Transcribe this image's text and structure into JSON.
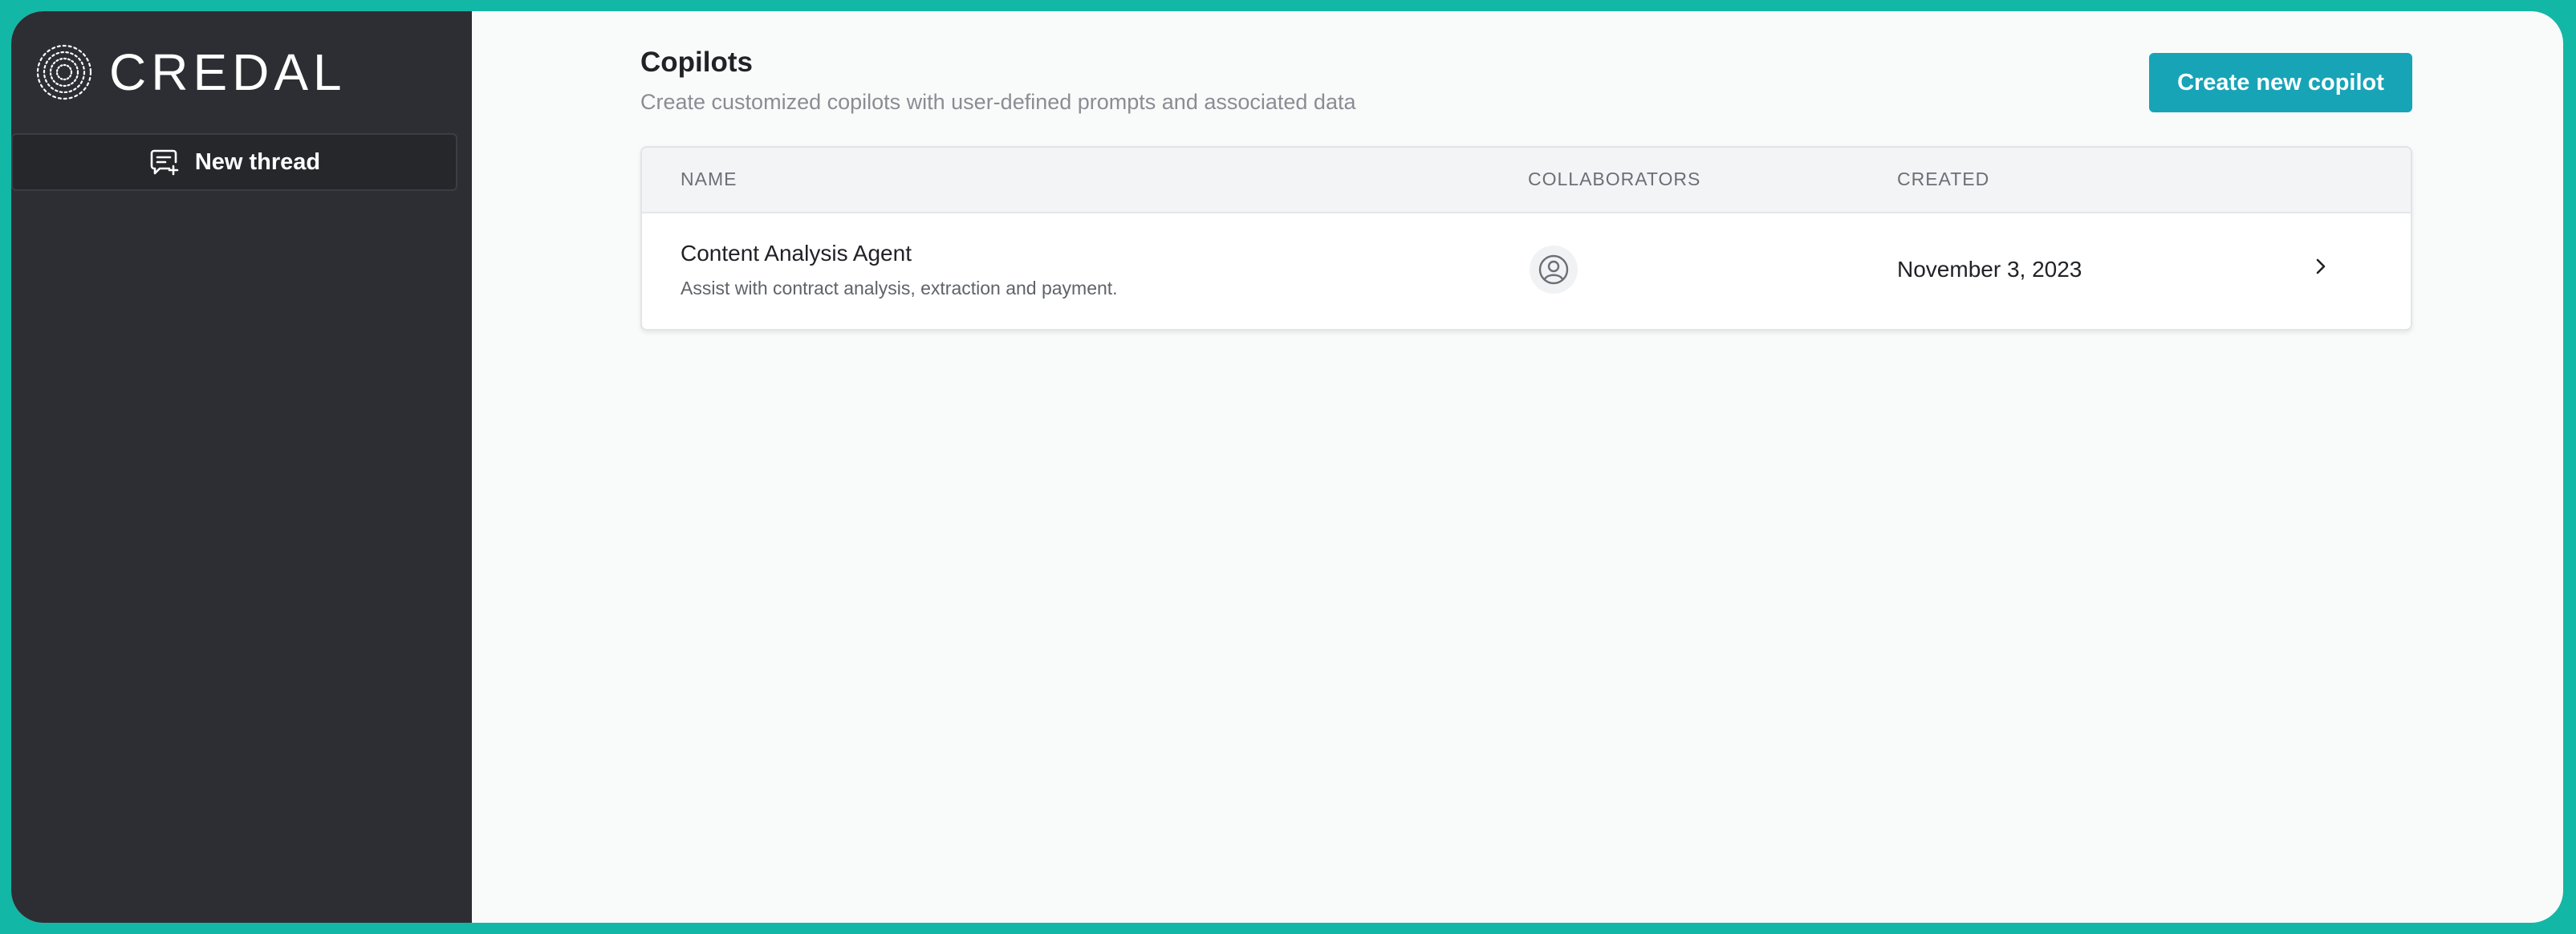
{
  "brand": {
    "name": "CREDAL"
  },
  "sidebar": {
    "new_thread_label": "New thread"
  },
  "page": {
    "title": "Copilots",
    "subtitle": "Create customized copilots with user-defined prompts and associated data",
    "create_button_label": "Create new copilot"
  },
  "table": {
    "columns": {
      "name": "NAME",
      "collaborators": "COLLABORATORS",
      "created": "CREATED"
    },
    "rows": [
      {
        "name": "Content Analysis Agent",
        "description": "Assist with contract analysis, extraction and payment.",
        "collaborator_icon": "user-circle-icon",
        "created": "November 3, 2023"
      }
    ]
  },
  "colors": {
    "frame": "#13b7a6",
    "sidebar": "#2c2e33",
    "accent": "#17a4b7",
    "background": "#f9fbfb"
  },
  "icons": {
    "logo": "credal-logo-icon",
    "new_thread": "chat-plus-icon",
    "collaborator": "user-circle-icon",
    "row_action": "chevron-right-icon"
  }
}
